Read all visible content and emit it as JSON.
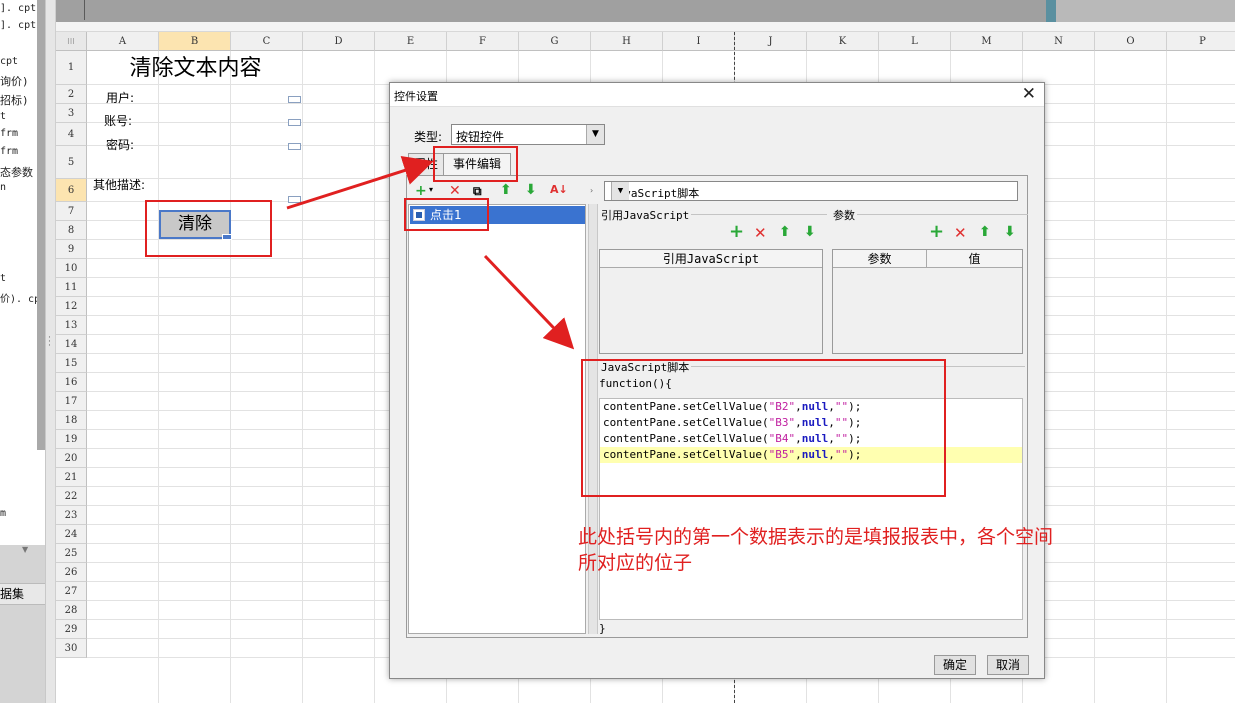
{
  "explorer": {
    "items": [
      "]. cpt",
      "]. cpt",
      "cpt",
      "询价)",
      "招标)",
      "t",
      "frm",
      "frm",
      "态参数",
      "n",
      "t",
      "价). cp",
      "m"
    ],
    "dataset_tab": "据集"
  },
  "sheet": {
    "columns": [
      "A",
      "B",
      "C",
      "D",
      "E",
      "F",
      "G",
      "H",
      "I",
      "J",
      "K",
      "L",
      "M",
      "N",
      "O",
      "P"
    ],
    "rows": [
      "1",
      "2",
      "3",
      "4",
      "5",
      "6",
      "7",
      "8",
      "9",
      "10",
      "11",
      "12",
      "13",
      "14",
      "15",
      "16",
      "17",
      "18",
      "19",
      "20",
      "21",
      "22",
      "23",
      "24",
      "25",
      "26",
      "27",
      "28",
      "29",
      "30"
    ],
    "selected_column": "B",
    "selected_row": "6",
    "title": "清除文本内容",
    "labels": {
      "user": "用户:",
      "account": "账号:",
      "password": "密码:",
      "other": "其他描述:"
    },
    "clear_button": "清除"
  },
  "dialog": {
    "title": "控件设置",
    "type_label": "类型:",
    "type_value": "按钮控件",
    "tabs": [
      "属性",
      "事件编辑"
    ],
    "active_tab": "事件编辑",
    "event_item": "点击1",
    "script_type": "JavaScript脚本",
    "ref_js_group": "引用JavaScript",
    "params_group": "参数",
    "ref_js_header": "引用JavaScript",
    "params_headers": [
      "参数",
      "值"
    ],
    "js_group": "JavaScript脚本",
    "fn_open": "function(){",
    "fn_close": "}",
    "code_lines": [
      {
        "prefix": "contentPane.setCellValue(",
        "cell": "\"B2\"",
        "mid": ",",
        "kw": "null",
        "sep": ",",
        "str": "\"\"",
        "end": ");"
      },
      {
        "prefix": "contentPane.setCellValue(",
        "cell": "\"B3\"",
        "mid": ",",
        "kw": "null",
        "sep": ",",
        "str": "\"\"",
        "end": ");"
      },
      {
        "prefix": "contentPane.setCellValue(",
        "cell": "\"B4\"",
        "mid": ",",
        "kw": "null",
        "sep": ",",
        "str": "\"\"",
        "end": ");"
      },
      {
        "prefix": "contentPane.setCellValue(",
        "cell": "\"B5\"",
        "mid": ",",
        "kw": "null",
        "sep": ",",
        "str": "\"\"",
        "end": ");"
      }
    ],
    "ok": "确定",
    "cancel": "取消"
  },
  "annotation": {
    "line1": "此处括号内的第一个数据表示的是填报报表中，各个空间",
    "line2": "所对应的位子"
  },
  "colors": {
    "highlight": "#e02020",
    "selection": "#3a73d0",
    "header_selected": "#fce4b0"
  }
}
